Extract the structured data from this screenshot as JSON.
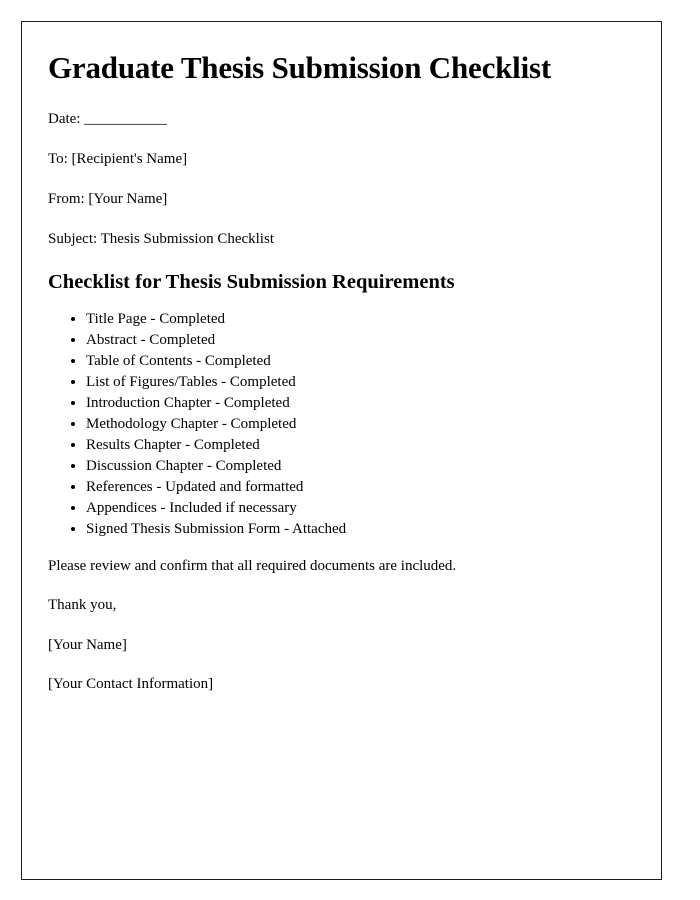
{
  "document": {
    "title": "Graduate Thesis Submission Checklist",
    "meta": [
      {
        "label": "Date:",
        "value": "___________",
        "text": "Date: ___________"
      },
      {
        "label": "To:",
        "value": "[Recipient's Name]",
        "text": "To: [Recipient's Name]"
      },
      {
        "label": "From:",
        "value": "[Your Name]",
        "text": "From: [Your Name]"
      },
      {
        "label": "Subject:",
        "value": "Thesis Submission Checklist",
        "text": "Subject: Thesis Submission Checklist"
      }
    ],
    "section_heading": "Checklist for Thesis Submission Requirements",
    "checklist": [
      "Title Page - Completed",
      "Abstract - Completed",
      "Table of Contents - Completed",
      "List of Figures/Tables - Completed",
      "Introduction Chapter - Completed",
      "Methodology Chapter - Completed",
      "Results Chapter - Completed",
      "Discussion Chapter - Completed",
      "References - Updated and formatted",
      "Appendices - Included if necessary",
      "Signed Thesis Submission Form - Attached"
    ],
    "closing": [
      "Please review and confirm that all required documents are included.",
      "Thank you,",
      "[Your Name]",
      "[Your Contact Information]"
    ],
    "colors": {
      "page_background": "#ffffff",
      "text": "#000000",
      "border": "#1c1c1c"
    }
  }
}
